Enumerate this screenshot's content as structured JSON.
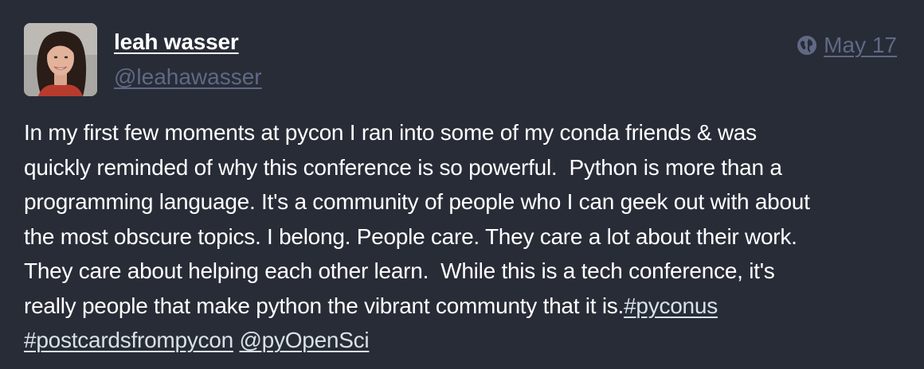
{
  "author": {
    "display_name": "leah wasser",
    "handle": "@leahawasser"
  },
  "meta": {
    "visibility_icon": "globe-icon",
    "date": "May 17"
  },
  "post": {
    "lines": [
      "In my first few moments at pycon I ran into some of my conda friends & was",
      "quickly reminded of why this conference is so powerful.  Python is more than a",
      "programming language. It's a community of people who I can geek out with about",
      "the most obscure topics. I belong. People care. They care a lot about their work.",
      "They care about helping each other learn.  While this is a tech conference, it's"
    ],
    "line6_text": "really people that make python the vibrant communty that it is.",
    "hashtag_pyconus": "#pyconus",
    "hashtag_postcards": "#postcardsfrompycon",
    "mention_pyopensci": "@pyOpenSci"
  },
  "colors": {
    "background": "#282c37",
    "text": "#ffffff",
    "muted": "#606984",
    "link": "#d9e1e8"
  }
}
